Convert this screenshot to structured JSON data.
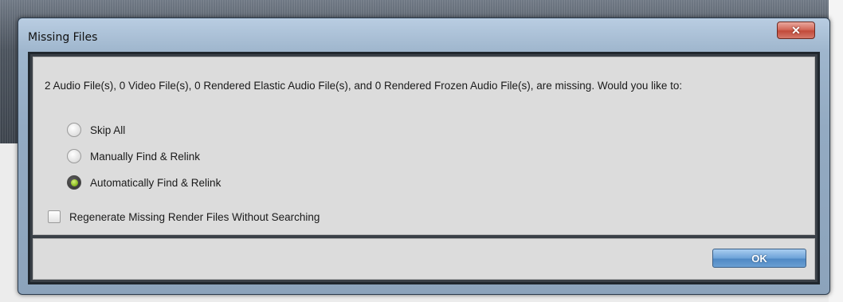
{
  "dialog": {
    "title": "Missing Files",
    "close_symbol": "✕",
    "message": "2 Audio File(s), 0 Video File(s), 0 Rendered Elastic Audio File(s), and 0 Rendered Frozen Audio File(s), are missing. Would you like to:",
    "options": [
      {
        "label": "Skip All",
        "selected": false
      },
      {
        "label": "Manually Find & Relink",
        "selected": false
      },
      {
        "label": "Automatically Find & Relink",
        "selected": true
      }
    ],
    "checkbox": {
      "label": "Regenerate Missing Render Files Without Searching",
      "checked": false
    },
    "ok_label": "OK"
  },
  "colors": {
    "selected_radio": "#8fbf24",
    "ok_button": "#5b93cc",
    "close_button": "#c24a3a"
  },
  "icons": {
    "close": "close-icon"
  }
}
